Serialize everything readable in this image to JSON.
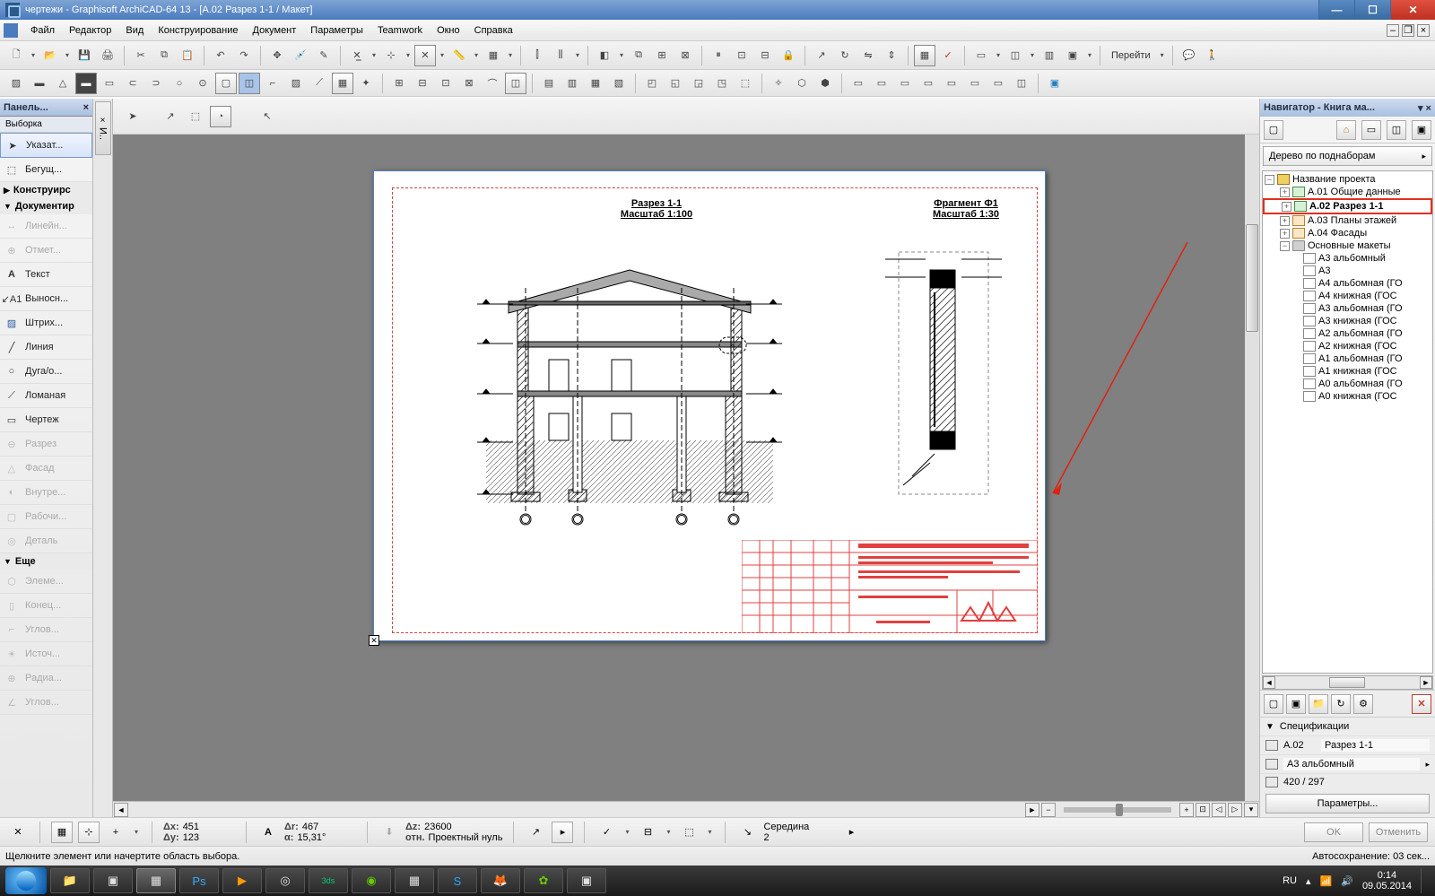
{
  "title": "чертежи - Graphisoft ArchiCAD-64 13 - [A.02 Разрез 1-1 / Макет]",
  "menu": [
    "Файл",
    "Редактор",
    "Вид",
    "Конструирование",
    "Документ",
    "Параметры",
    "Teamwork",
    "Окно",
    "Справка"
  ],
  "toolbar_goto": "Перейти",
  "left_panel": {
    "title": "Панель...",
    "sub": "Выборка",
    "tools": {
      "pointer": "Указат...",
      "marquee": "Бегущ...",
      "cat_construct": "Конструирс",
      "cat_document": "Документир",
      "linear": "Линейн...",
      "level": "Отмет...",
      "text": "Текст",
      "label": "Выносн...",
      "hatch": "Штрих...",
      "line": "Линия",
      "arc": "Дуга/о...",
      "polyline": "Ломаная",
      "drawing": "Чертеж",
      "section": "Разрез",
      "elevation": "Фасад",
      "interior": "Внутре...",
      "worksheet": "Рабочи...",
      "detail": "Деталь",
      "cat_more": "Еще",
      "element": "Элеме...",
      "endpt": "Конец...",
      "corner": "Углов...",
      "source": "Источ...",
      "radial": "Радиа...",
      "corner2": "Углов..."
    }
  },
  "drawing": {
    "title1_a": "Разрез 1-1",
    "title1_b": "Масштаб 1:100",
    "title2_a": "Фрагмент Ф1",
    "title2_b": "Масштаб 1:30"
  },
  "navigator": {
    "title": "Навигатор - Книга ма...",
    "dropdown": "Дерево по поднаборам",
    "root": "Название проекта",
    "items": {
      "a01": "А.01 Общие данные",
      "a02": "А.02 Разрез 1-1",
      "a03": "А.03 Планы этажей",
      "a04": "А.04 Фасады",
      "masters": "Основные макеты",
      "m": [
        "А3 альбомный",
        "А3",
        "А4 альбомная (ГО",
        "А4 книжная (ГОС",
        "А3 альбомная (ГО",
        "А3 книжная (ГОС",
        "А2 альбомная (ГО",
        "А2 книжная (ГОС",
        "А1 альбомная (ГО",
        "А1 книжная (ГОС",
        "А0 альбомная (ГО",
        "А0 книжная (ГОС"
      ]
    },
    "spec_header": "Спецификации",
    "spec_id": "A.02",
    "spec_name": "Разрез 1-1",
    "spec_layout": "А3 альбомный",
    "spec_size": "420 / 297",
    "params_btn": "Параметры..."
  },
  "coordbar": {
    "dx": "Δx:",
    "dx_v": "451",
    "dy": "Δy:",
    "dy_v": "123",
    "dr": "Δr:",
    "dr_v": "467",
    "da": "α:",
    "da_v": "15,31°",
    "dz": "Δz:",
    "dz_v": "23600",
    "ref": "отн.",
    "ref_v": "Проектный нуль",
    "snap": "Середина",
    "snap_v": "2",
    "ok": "OK",
    "cancel": "Отменить"
  },
  "status": {
    "hint": "Щелкните элемент или начертите область выбора.",
    "autosave": "Автосохранение: 03 сек..."
  },
  "taskbar": {
    "lang": "RU",
    "time": "0:14",
    "date": "09.05.2014"
  }
}
